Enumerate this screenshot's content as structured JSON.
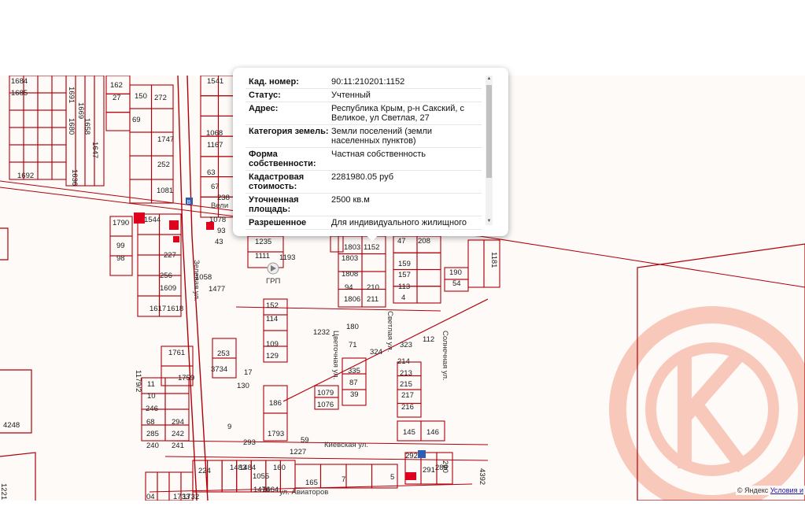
{
  "popup": {
    "rows": [
      {
        "key": "Кад. номер:",
        "value": "90:11:210201:1152"
      },
      {
        "key": "Статус:",
        "value": "Учтенный"
      },
      {
        "key": "Адрес:",
        "value": "Республика Крым, р-н Сакский, с Великое, ул Светлая, 27"
      },
      {
        "key": "Категория земель:",
        "value": "Земли поселений (земли населенных пунктов)"
      },
      {
        "key": "Форма собственности:",
        "value": "Частная собственность"
      },
      {
        "key": "Кадастровая стоимость:",
        "value": "2281980.05 руб"
      },
      {
        "key": "Уточненная площадь:",
        "value": "2500 кв.м"
      },
      {
        "key": "Разрешенное",
        "value": "Для индивидуального жилищного"
      }
    ]
  },
  "map": {
    "parcel_labels": [
      "1684",
      "1685",
      "1680",
      "1691",
      "1669",
      "1658",
      "1647",
      "1636",
      "1692",
      "162",
      "27",
      "150",
      "272",
      "69",
      "1541",
      "1068",
      "1167",
      "1747",
      "252",
      "63",
      "67",
      "238",
      "1081",
      "1078",
      "93",
      "43",
      "1790",
      "1544",
      "99",
      "98",
      "227",
      "1235",
      "1111",
      "1193",
      "1803",
      "1808",
      "94",
      "210",
      "1806",
      "211",
      "159",
      "157",
      "113",
      "4",
      "190",
      "54",
      "47",
      "208",
      "1152",
      "1803",
      "256",
      "1609",
      "1477",
      "152",
      "114",
      "109",
      "129",
      "1232",
      "180",
      "71",
      "324",
      "323",
      "112",
      "214",
      "1617",
      "1618",
      "1761",
      "253",
      "3734",
      "17",
      "130",
      "213",
      "215",
      "217",
      "216",
      "335",
      "87",
      "39",
      "1079",
      "1076",
      "186",
      "1759",
      "11",
      "10",
      "246",
      "68",
      "294",
      "285",
      "242",
      "240",
      "241",
      "9",
      "293",
      "1793",
      "59",
      "145",
      "146",
      "1227",
      "224",
      "1483",
      "1484",
      "1055",
      "160",
      "1476",
      "1464",
      "165",
      "292",
      "291",
      "289",
      "290",
      "4392",
      "1179/2",
      "4248",
      "1221",
      "1181",
      "1058",
      "1733",
      "1732",
      "04",
      "7",
      "5"
    ],
    "streets": [
      "Зеленая ул.",
      "Светлая ул.",
      "Киевская ул.",
      "ул. Авиаторов",
      "Солнечная ул.",
      "Цветочная ул.",
      "ГРП",
      "Вели"
    ],
    "line_color": "#b0000a"
  },
  "attribution": {
    "copyright": "© Яндекс",
    "terms": "Условия и"
  }
}
